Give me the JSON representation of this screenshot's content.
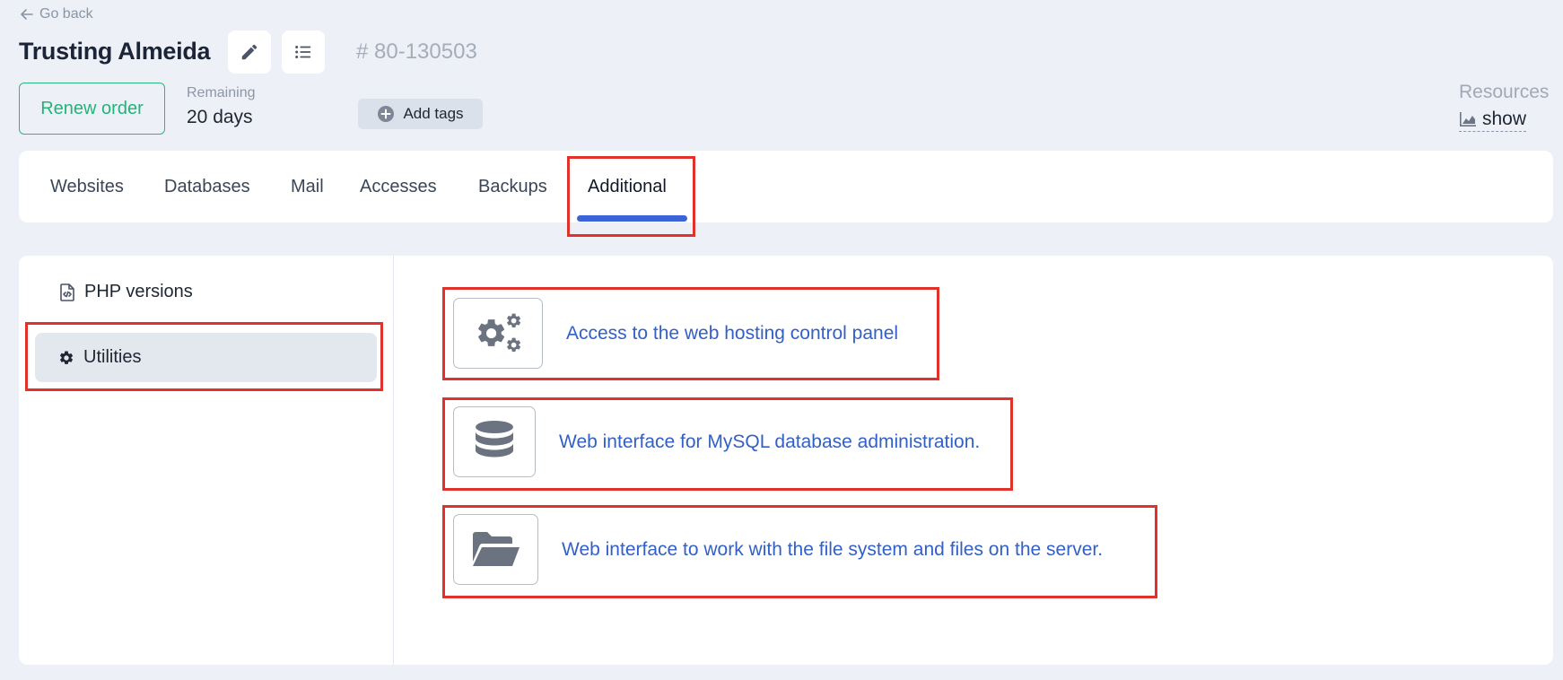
{
  "nav": {
    "go_back": "Go back"
  },
  "header": {
    "title": "Trusting Almeida",
    "order_number": "# 80-130503",
    "renew_label": "Renew order",
    "remaining_label": "Remaining",
    "remaining_value": "20 days",
    "add_tags_label": "Add tags",
    "resources_label": "Resources",
    "resources_show": "show"
  },
  "tabs": [
    {
      "label": "Websites"
    },
    {
      "label": "Databases"
    },
    {
      "label": "Mail"
    },
    {
      "label": "Accesses"
    },
    {
      "label": "Backups"
    },
    {
      "label": "Additional",
      "active": true
    }
  ],
  "sidebar": {
    "items": [
      {
        "label": "PHP versions",
        "icon": "php-file-icon"
      },
      {
        "label": "Utilities",
        "icon": "gear-icon",
        "active": true
      }
    ]
  },
  "utilities": [
    {
      "label": "Access to the web hosting control panel",
      "icon": "gears-icon"
    },
    {
      "label": "Web interface for MySQL database administration.",
      "icon": "database-icon"
    },
    {
      "label": "Web interface to work with the file system and files on the server.",
      "icon": "folder-open-icon"
    }
  ],
  "colors": {
    "accent": "#3b64d9",
    "link": "#3260c7",
    "renew_green": "#22b37a",
    "highlight": "#e0312b"
  }
}
